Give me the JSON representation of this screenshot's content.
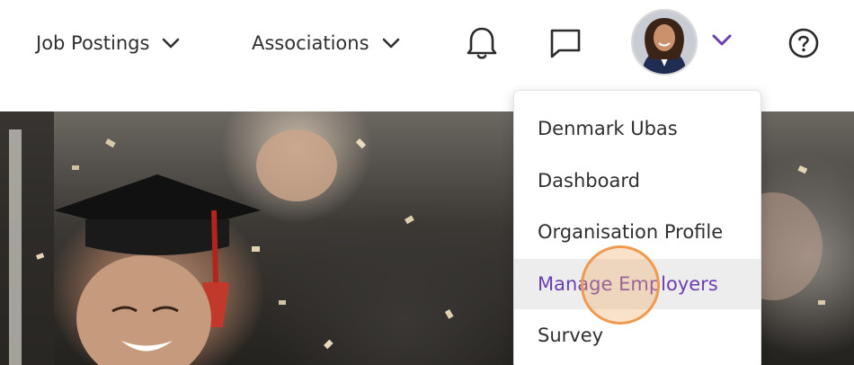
{
  "nav": {
    "job_postings": "Job Postings",
    "associations": "Associations"
  },
  "icons": {
    "notifications": "bell-icon",
    "messages": "chat-icon",
    "help": "help-icon",
    "profile_menu": "chevron-down-icon"
  },
  "user_menu": {
    "items": [
      {
        "label": "Denmark Ubas",
        "active": false
      },
      {
        "label": "Dashboard",
        "active": false
      },
      {
        "label": "Organisation Profile",
        "active": false
      },
      {
        "label": "Manage Employers",
        "active": true
      },
      {
        "label": "Survey",
        "active": false
      }
    ]
  },
  "colors": {
    "accent": "#6a3fb2",
    "highlight_bg": "#ededed",
    "click_indicator": "#ef9a4f"
  }
}
